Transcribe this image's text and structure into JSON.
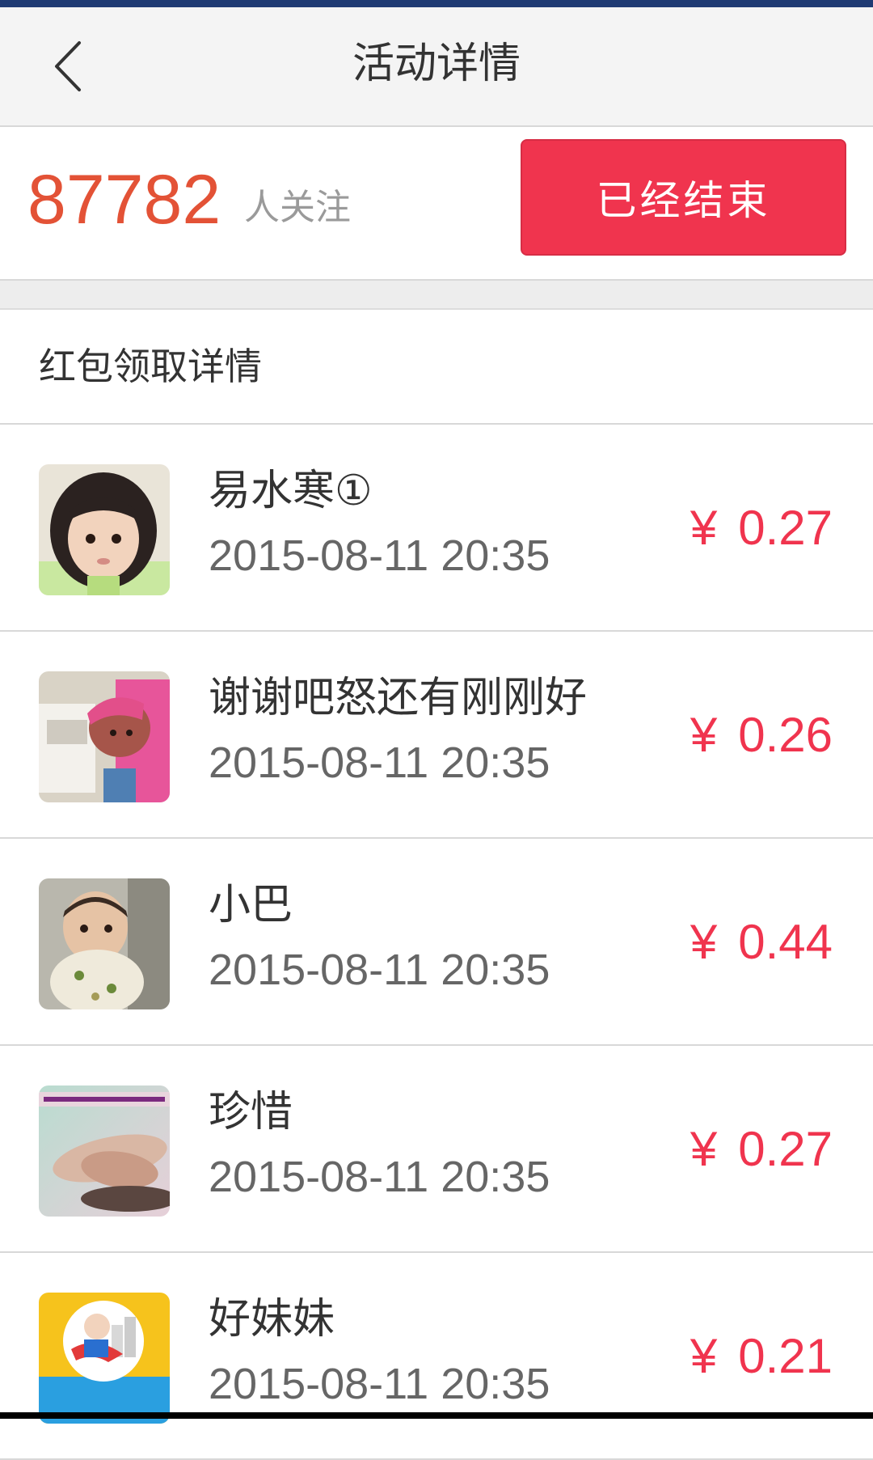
{
  "header": {
    "title": "活动详情",
    "back_icon": "chevron-left-icon"
  },
  "stats": {
    "followers_count": "87782",
    "followers_label": "人关注",
    "status_button": "已经结束"
  },
  "section": {
    "title": "红包领取详情"
  },
  "records": [
    {
      "name": "易水寒①",
      "time": "2015-08-11  20:35",
      "currency": "¥",
      "amount": "0.27"
    },
    {
      "name": "谢谢吧怒还有刚刚好",
      "time": "2015-08-11  20:35",
      "currency": "¥",
      "amount": "0.26"
    },
    {
      "name": "小巴",
      "time": "2015-08-11  20:35",
      "currency": "¥",
      "amount": "0.44"
    },
    {
      "name": "珍惜",
      "time": "2015-08-11  20:35",
      "currency": "¥",
      "amount": "0.27"
    },
    {
      "name": "好妹妹",
      "time": "2015-08-11  20:35",
      "currency": "¥",
      "amount": "0.21"
    }
  ],
  "colors": {
    "accent_red": "#f0344e",
    "count_orange": "#e35236",
    "status_bar": "#1f3a73"
  }
}
